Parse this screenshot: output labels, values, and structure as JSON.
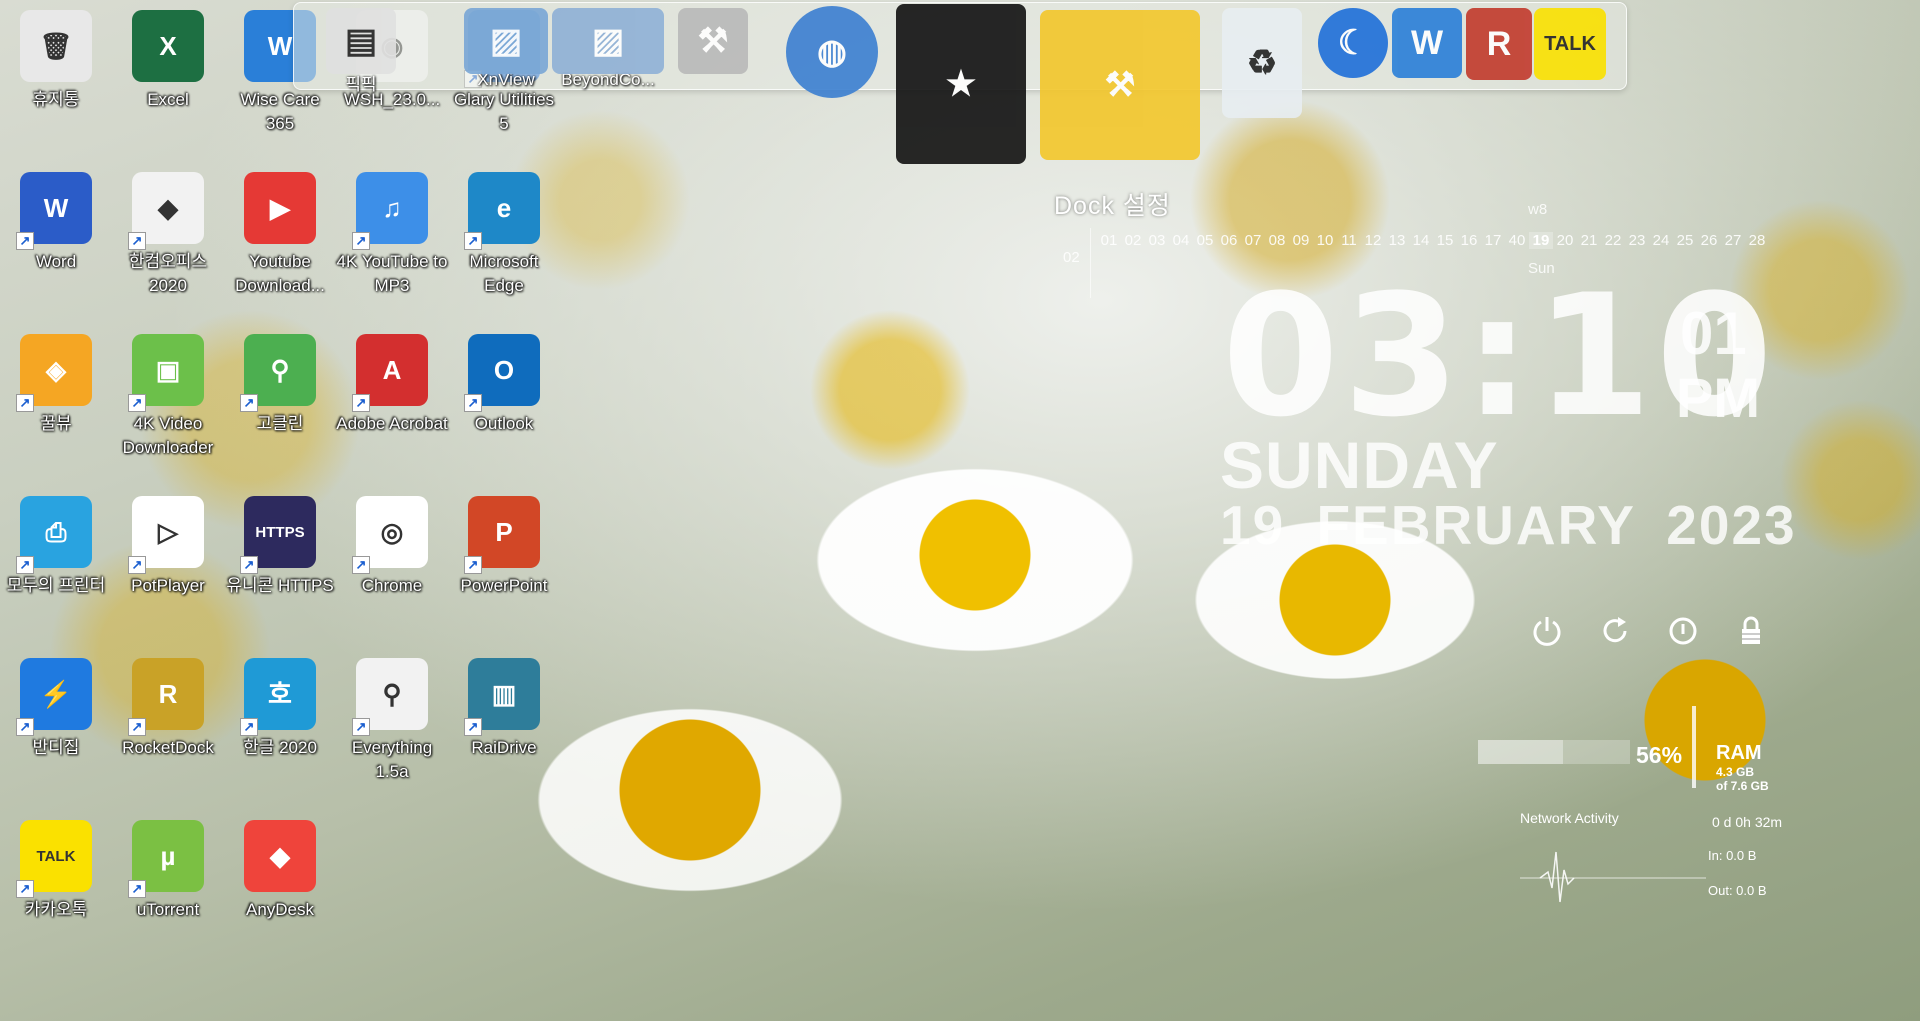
{
  "desktop_icons": [
    {
      "label": "휴지통",
      "icon": "recycle-bin-icon",
      "color": "#e8e8e8",
      "glyph": "🗑",
      "shortcut": false
    },
    {
      "label": "Excel",
      "icon": "excel-icon",
      "color": "#1d6f42",
      "glyph": "X",
      "shortcut": false
    },
    {
      "label": "Wise Care 365",
      "icon": "wise-care-icon",
      "color": "#2a7fd8",
      "glyph": "W",
      "shortcut": false
    },
    {
      "label": "WSH_23.0...",
      "icon": "disc-image-icon",
      "color": "#f4f4f4",
      "glyph": "◉",
      "shortcut": false
    },
    {
      "label": "Glary Utilities 5",
      "icon": "glary-utilities-icon",
      "color": "#1e6fd9",
      "glyph": "☾",
      "shortcut": true
    },
    {
      "label": "Word",
      "icon": "word-icon",
      "color": "#2b5cc8",
      "glyph": "W",
      "shortcut": true
    },
    {
      "label": "한컴오피스 2020",
      "icon": "hancom-office-icon",
      "color": "#f2f2f2",
      "glyph": "◆",
      "shortcut": true
    },
    {
      "label": "Youtube Download...",
      "icon": "youtube-downloader-icon",
      "color": "#e53935",
      "glyph": "▶",
      "shortcut": false
    },
    {
      "label": "4K YouTube to MP3",
      "icon": "4k-youtube-mp3-icon",
      "color": "#3d8fe8",
      "glyph": "♫",
      "shortcut": true
    },
    {
      "label": "Microsoft Edge",
      "icon": "edge-icon",
      "color": "#1e88c8",
      "glyph": "e",
      "shortcut": true
    },
    {
      "label": "꿀뷰",
      "icon": "honeyview-icon",
      "color": "#f5a623",
      "glyph": "◈",
      "shortcut": true
    },
    {
      "label": "4K Video Downloader",
      "icon": "4k-video-downloader-icon",
      "color": "#6cc04a",
      "glyph": "▣",
      "shortcut": true
    },
    {
      "label": "고클린",
      "icon": "goclean-icon",
      "color": "#4caf50",
      "glyph": "⚲",
      "shortcut": true
    },
    {
      "label": "Adobe Acrobat",
      "icon": "acrobat-icon",
      "color": "#d32f2f",
      "glyph": "A",
      "shortcut": true
    },
    {
      "label": "Outlook",
      "icon": "outlook-icon",
      "color": "#0f6cbd",
      "glyph": "O",
      "shortcut": true
    },
    {
      "label": "모두의 프린터",
      "icon": "printer-icon",
      "color": "#29a3e0",
      "glyph": "⎙",
      "shortcut": true
    },
    {
      "label": "PotPlayer",
      "icon": "potplayer-icon",
      "color": "#ffffff",
      "glyph": "▷",
      "shortcut": true
    },
    {
      "label": "유니콘 HTTPS",
      "icon": "unicorn-https-icon",
      "color": "#2d2a5e",
      "glyph": "HTTPS",
      "shortcut": true
    },
    {
      "label": "Chrome",
      "icon": "chrome-icon",
      "color": "#ffffff",
      "glyph": "◎",
      "shortcut": true
    },
    {
      "label": "PowerPoint",
      "icon": "powerpoint-icon",
      "color": "#d24726",
      "glyph": "P",
      "shortcut": true
    },
    {
      "label": "반디집",
      "icon": "bandizip-icon",
      "color": "#1f7ae0",
      "glyph": "⚡",
      "shortcut": true
    },
    {
      "label": "RocketDock",
      "icon": "rocketdock-icon",
      "color": "#c9a227",
      "glyph": "R",
      "shortcut": true
    },
    {
      "label": "한글 2020",
      "icon": "hangul-icon",
      "color": "#1f9ad6",
      "glyph": "호",
      "shortcut": true
    },
    {
      "label": "Everything 1.5a",
      "icon": "everything-search-icon",
      "color": "#f2f2f2",
      "glyph": "⚲",
      "shortcut": true
    },
    {
      "label": "RaiDrive",
      "icon": "raidrive-icon",
      "color": "#2e7d9a",
      "glyph": "▥",
      "shortcut": true
    },
    {
      "label": "카카오톡",
      "icon": "kakaotalk-icon",
      "color": "#fae100",
      "glyph": "TALK",
      "shortcut": true
    },
    {
      "label": "uTorrent",
      "icon": "utorrent-icon",
      "color": "#7bc043",
      "glyph": "µ",
      "shortcut": true
    },
    {
      "label": "AnyDesk",
      "icon": "anydesk-icon",
      "color": "#ef443b",
      "glyph": "◆",
      "shortcut": false
    }
  ],
  "dock": {
    "items": [
      {
        "label": "픽픽",
        "icon": "picpick-icon"
      },
      {
        "label": "XnView",
        "icon": "xnview-icon"
      },
      {
        "label": "BeyondCo...",
        "icon": "beyond-compare-icon"
      },
      {
        "label": "",
        "icon": "tools-icon"
      },
      {
        "label": "",
        "icon": "globe-icon"
      },
      {
        "label": "",
        "icon": "tshirt-icon"
      },
      {
        "label": "",
        "icon": "hammer-icon"
      },
      {
        "label": "",
        "icon": "recycle-bin-icon"
      },
      {
        "label": "",
        "icon": "glary-utilities-icon"
      },
      {
        "label": "",
        "icon": "wise-care-icon"
      },
      {
        "label": "",
        "icon": "rocketdock-settings-icon"
      },
      {
        "label": "TALK",
        "icon": "kakaotalk-icon"
      }
    ],
    "settings_label": "Dock 설정"
  },
  "calendar": {
    "month": "02",
    "week": "w8",
    "days": [
      "01",
      "02",
      "03",
      "04",
      "05",
      "06",
      "07",
      "08",
      "09",
      "10",
      "11",
      "12",
      "13",
      "14",
      "15",
      "16",
      "17",
      "40",
      "19",
      "20",
      "21",
      "22",
      "23",
      "24",
      "25",
      "26",
      "27",
      "28"
    ],
    "today": "19",
    "today_dow": "Sun"
  },
  "clock": {
    "time": "03:10",
    "seconds": "01",
    "ampm": "PM",
    "day": "SUNDAY",
    "date": "19 FEBRUARY 2023"
  },
  "system": {
    "ram_percent": 56,
    "ram_percent_text": "56%",
    "ram_label": "RAM",
    "ram_used": "4.3 GB",
    "ram_total": "of 7.6 GB",
    "uptime": "0 d 0h 32m",
    "network_title": "Network Activity",
    "net_in": "In: 0.0 B",
    "net_out": "Out: 0.0 B"
  },
  "colors": {
    "accent_green": "#4caf50"
  }
}
